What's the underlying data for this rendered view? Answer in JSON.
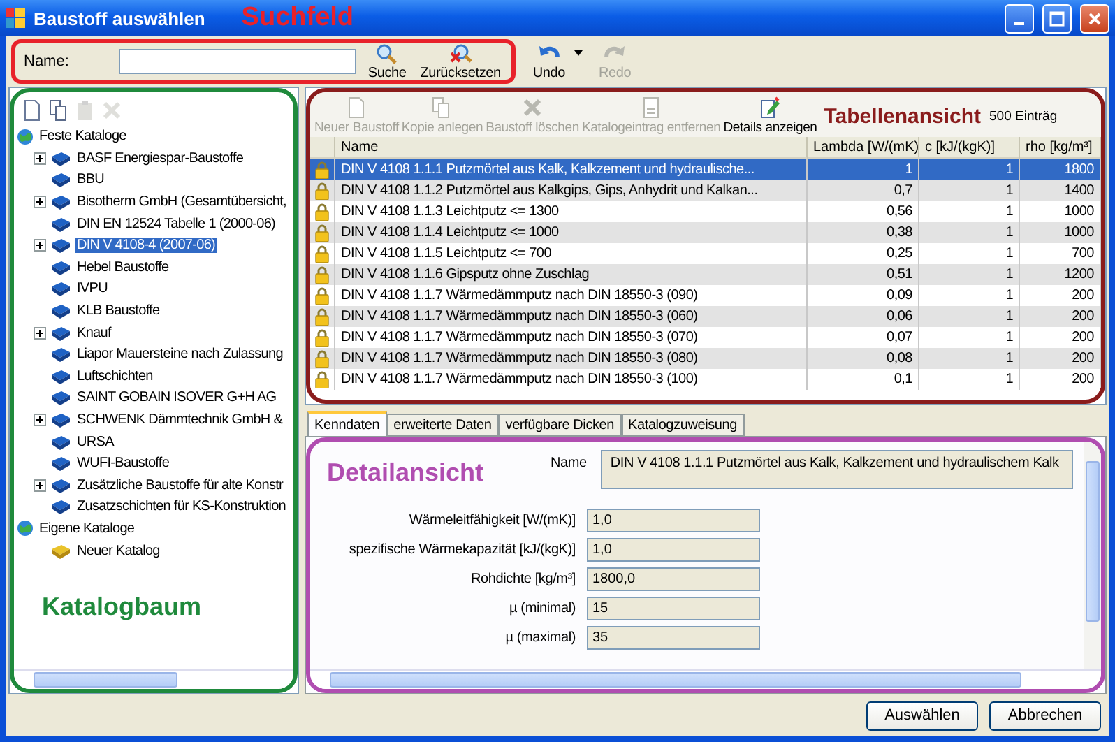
{
  "window": {
    "title": "Baustoff auswählen"
  },
  "search_bar": {
    "annotation": {
      "label": "Suchfeld",
      "color": "#e8222a"
    },
    "name_label": "Name:",
    "buttons": [
      {
        "kind": "search",
        "label": "Suche",
        "disabled": false
      },
      {
        "kind": "reset",
        "label": "Zurücksetzen",
        "disabled": false
      }
    ],
    "history": [
      {
        "kind": "undo",
        "label": "Undo",
        "disabled": false,
        "dropdown": true
      },
      {
        "kind": "redo",
        "label": "Redo",
        "disabled": true,
        "dropdown": false
      }
    ]
  },
  "tree": {
    "annotation": {
      "label": "Katalogbaum",
      "color": "#1f8a3c"
    },
    "toolbar": [
      {
        "kind": "new",
        "disabled": false
      },
      {
        "kind": "copy",
        "disabled": false
      },
      {
        "kind": "paste",
        "disabled": true
      },
      {
        "kind": "delete",
        "disabled": true
      }
    ],
    "nodes": [
      {
        "label": "Feste Kataloge",
        "kind": "root",
        "selected": false,
        "expandable": false,
        "children": [
          {
            "label": "BASF Energiespar-Baustoffe",
            "kind": "catalog",
            "selected": false,
            "expandable": true
          },
          {
            "label": "BBU",
            "kind": "catalog",
            "selected": false,
            "expandable": false
          },
          {
            "label": "Bisotherm GmbH (Gesamtübersicht,",
            "kind": "catalog",
            "selected": false,
            "expandable": true
          },
          {
            "label": "DIN EN 12524 Tabelle 1 (2000-06)",
            "kind": "catalog",
            "selected": false,
            "expandable": false
          },
          {
            "label": "DIN V 4108-4 (2007-06)",
            "kind": "catalog",
            "selected": true,
            "expandable": true
          },
          {
            "label": "Hebel Baustoffe",
            "kind": "catalog",
            "selected": false,
            "expandable": false
          },
          {
            "label": "IVPU",
            "kind": "catalog",
            "selected": false,
            "expandable": false
          },
          {
            "label": "KLB Baustoffe",
            "kind": "catalog",
            "selected": false,
            "expandable": false
          },
          {
            "label": "Knauf",
            "kind": "catalog",
            "selected": false,
            "expandable": true
          },
          {
            "label": "Liapor Mauersteine nach Zulassung",
            "kind": "catalog",
            "selected": false,
            "expandable": false
          },
          {
            "label": "Luftschichten",
            "kind": "catalog",
            "selected": false,
            "expandable": false
          },
          {
            "label": "SAINT GOBAIN ISOVER G+H AG",
            "kind": "catalog",
            "selected": false,
            "expandable": false
          },
          {
            "label": "SCHWENK Dämmtechnik GmbH &",
            "kind": "catalog",
            "selected": false,
            "expandable": true
          },
          {
            "label": "URSA",
            "kind": "catalog",
            "selected": false,
            "expandable": false
          },
          {
            "label": "WUFI-Baustoffe",
            "kind": "catalog",
            "selected": false,
            "expandable": false
          },
          {
            "label": "Zusätzliche Baustoffe für alte Konstr",
            "kind": "catalog",
            "selected": false,
            "expandable": true
          },
          {
            "label": "Zusatzschichten für KS-Konstruktion",
            "kind": "catalog",
            "selected": false,
            "expandable": false
          }
        ]
      },
      {
        "label": "Eigene Kataloge",
        "kind": "root",
        "selected": false,
        "expandable": false,
        "children": [
          {
            "label": "Neuer Katalog",
            "kind": "own",
            "selected": false,
            "expandable": false
          }
        ]
      }
    ]
  },
  "table": {
    "annotation": {
      "label": "Tabellenansicht",
      "color": "#8a1c1c"
    },
    "toolbar": [
      {
        "kind": "new",
        "label": "Neuer Baustoff",
        "disabled": true
      },
      {
        "kind": "copy",
        "label": "Kopie anlegen",
        "disabled": true
      },
      {
        "kind": "delete",
        "label": "Baustoff löschen",
        "disabled": true
      },
      {
        "kind": "remove",
        "label": "Katalogeintrag entfernen",
        "disabled": true
      },
      {
        "kind": "details",
        "label": "Details anzeigen",
        "disabled": false
      }
    ],
    "count": "500 Einträg",
    "columns": [
      "Name",
      "Lambda [W/(mK)]",
      "c [kJ/(kgK)]",
      "rho [kg/m³]"
    ],
    "rows": [
      {
        "locked": true,
        "selected": true,
        "cells": [
          "DIN V 4108 1.1.1 Putzmörtel aus Kalk, Kalkzement und  hydraulische...",
          "1",
          "1",
          "1800"
        ]
      },
      {
        "locked": true,
        "selected": false,
        "cells": [
          "DIN V 4108 1.1.2 Putzmörtel aus Kalkgips, Gips, Anhydrit  und Kalkan...",
          "0,7",
          "1",
          "1400"
        ]
      },
      {
        "locked": true,
        "selected": false,
        "cells": [
          "DIN V 4108 1.1.3 Leichtputz <= 1300",
          "0,56",
          "1",
          "1000"
        ]
      },
      {
        "locked": true,
        "selected": false,
        "cells": [
          "DIN V 4108 1.1.4 Leichtputz <= 1000",
          "0,38",
          "1",
          "1000"
        ]
      },
      {
        "locked": true,
        "selected": false,
        "cells": [
          "DIN V 4108 1.1.5 Leichtputz <= 700",
          "0,25",
          "1",
          "700"
        ]
      },
      {
        "locked": true,
        "selected": false,
        "cells": [
          "DIN V 4108 1.1.6 Gipsputz ohne Zuschlag",
          "0,51",
          "1",
          "1200"
        ]
      },
      {
        "locked": true,
        "selected": false,
        "cells": [
          "DIN V 4108 1.1.7 Wärmedämmputz nach  DIN 18550-3 (090)",
          "0,09",
          "1",
          "200"
        ]
      },
      {
        "locked": true,
        "selected": false,
        "cells": [
          "DIN V 4108 1.1.7 Wärmedämmputz nach DIN 18550-3 (060)",
          "0,06",
          "1",
          "200"
        ]
      },
      {
        "locked": true,
        "selected": false,
        "cells": [
          "DIN V 4108 1.1.7 Wärmedämmputz nach DIN 18550-3 (070)",
          "0,07",
          "1",
          "200"
        ]
      },
      {
        "locked": true,
        "selected": false,
        "cells": [
          "DIN V 4108 1.1.7 Wärmedämmputz nach DIN 18550-3 (080)",
          "0,08",
          "1",
          "200"
        ]
      },
      {
        "locked": true,
        "selected": false,
        "cells": [
          "DIN V 4108 1.1.7 Wärmedämmputz nach DIN 18550-3 (100)",
          "0,1",
          "1",
          "200"
        ]
      }
    ]
  },
  "details": {
    "annotation": {
      "label": "Detailansicht",
      "color": "#b04db0"
    },
    "tabs": [
      {
        "label": "Kenndaten",
        "selected": true
      },
      {
        "label": "erweiterte Daten",
        "selected": false
      },
      {
        "label": "verfügbare Dicken",
        "selected": false
      },
      {
        "label": "Katalogzuweisung",
        "selected": false
      }
    ],
    "name": {
      "label": "Name",
      "value": "DIN V 4108 1.1.1 Putzmörtel aus Kalk, Kalkzement und  hydraulischem Kalk"
    },
    "fields": [
      {
        "label": "Wärmeleitfähigkeit [W/(mK)]",
        "value": "1,0"
      },
      {
        "label": "spezifische Wärmekapazität [kJ/(kgK)]",
        "value": "1,0"
      },
      {
        "label": "Rohdichte [kg/m³]",
        "value": "1800,0"
      },
      {
        "label": "µ (minimal)",
        "value": "15"
      },
      {
        "label": "µ (maximal)",
        "value": "35"
      }
    ]
  },
  "buttons": [
    "Auswählen",
    "Abbrechen"
  ]
}
